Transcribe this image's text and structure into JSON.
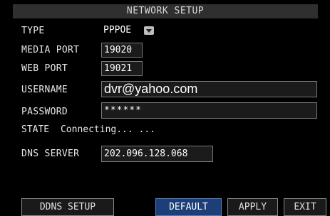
{
  "title": "NETWORK SETUP",
  "fields": {
    "type": {
      "label": "TYPE",
      "value": "PPPOE"
    },
    "media_port": {
      "label": "MEDIA PORT",
      "value": "19020"
    },
    "web_port": {
      "label": "WEB PORT",
      "value": "19021"
    },
    "username": {
      "label": "USERNAME",
      "value": "dvr@yahoo.com"
    },
    "password": {
      "label": "PASSWORD",
      "value": "******"
    },
    "state": {
      "label": "STATE",
      "value": "Connecting... ..."
    },
    "dns_server": {
      "label": "DNS SERVER",
      "value": "202.096.128.068"
    }
  },
  "buttons": {
    "ddns_setup": "DDNS SETUP",
    "default": "DEFAULT",
    "apply": "APPLY",
    "exit": "EXIT"
  },
  "colors": {
    "background": "#000000",
    "title_bar": "#2f2f2f",
    "active_button": "#1d3f78",
    "field_border": "#7a7a7a"
  },
  "icons": {
    "type_dropdown": "chevron-down-icon"
  }
}
